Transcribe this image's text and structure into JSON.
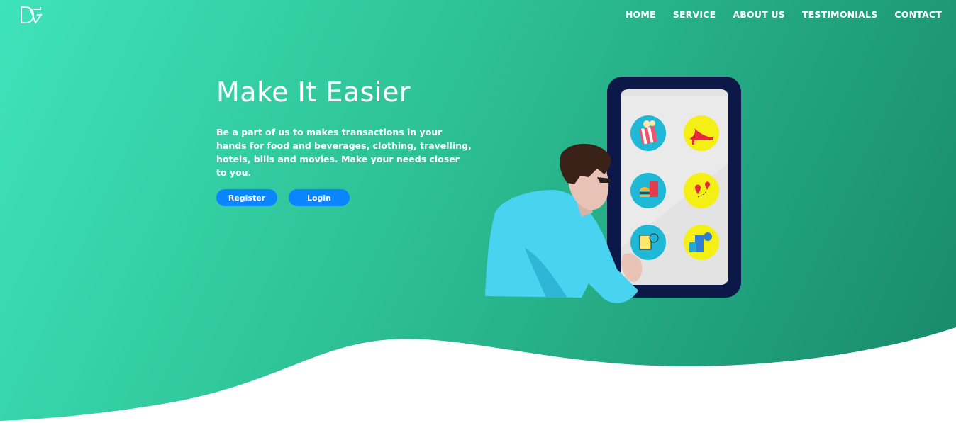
{
  "brand": {
    "logo_text": "DG"
  },
  "nav": {
    "items": [
      "HOME",
      "SERVICE",
      "ABOUT US",
      "TESTIMONIALS",
      "CONTACT"
    ]
  },
  "hero": {
    "title": "Make It Easier",
    "description": "Be a part of us to makes transactions in your hands for food and beverages, clothing, travelling, hotels, bills and movies. Make your needs closer to you.",
    "register_label": "Register",
    "login_label": "Login"
  },
  "illustration": {
    "app_icons": [
      "popcorn-icon",
      "high-heel-shoe-icon",
      "burger-drink-icon",
      "map-route-icon",
      "bill-payment-icon",
      "hotel-building-icon"
    ]
  },
  "colors": {
    "gradient_start": "#3fe3bb",
    "gradient_end": "#17886a",
    "button": "#0a84ff",
    "text": "#ffffff"
  }
}
